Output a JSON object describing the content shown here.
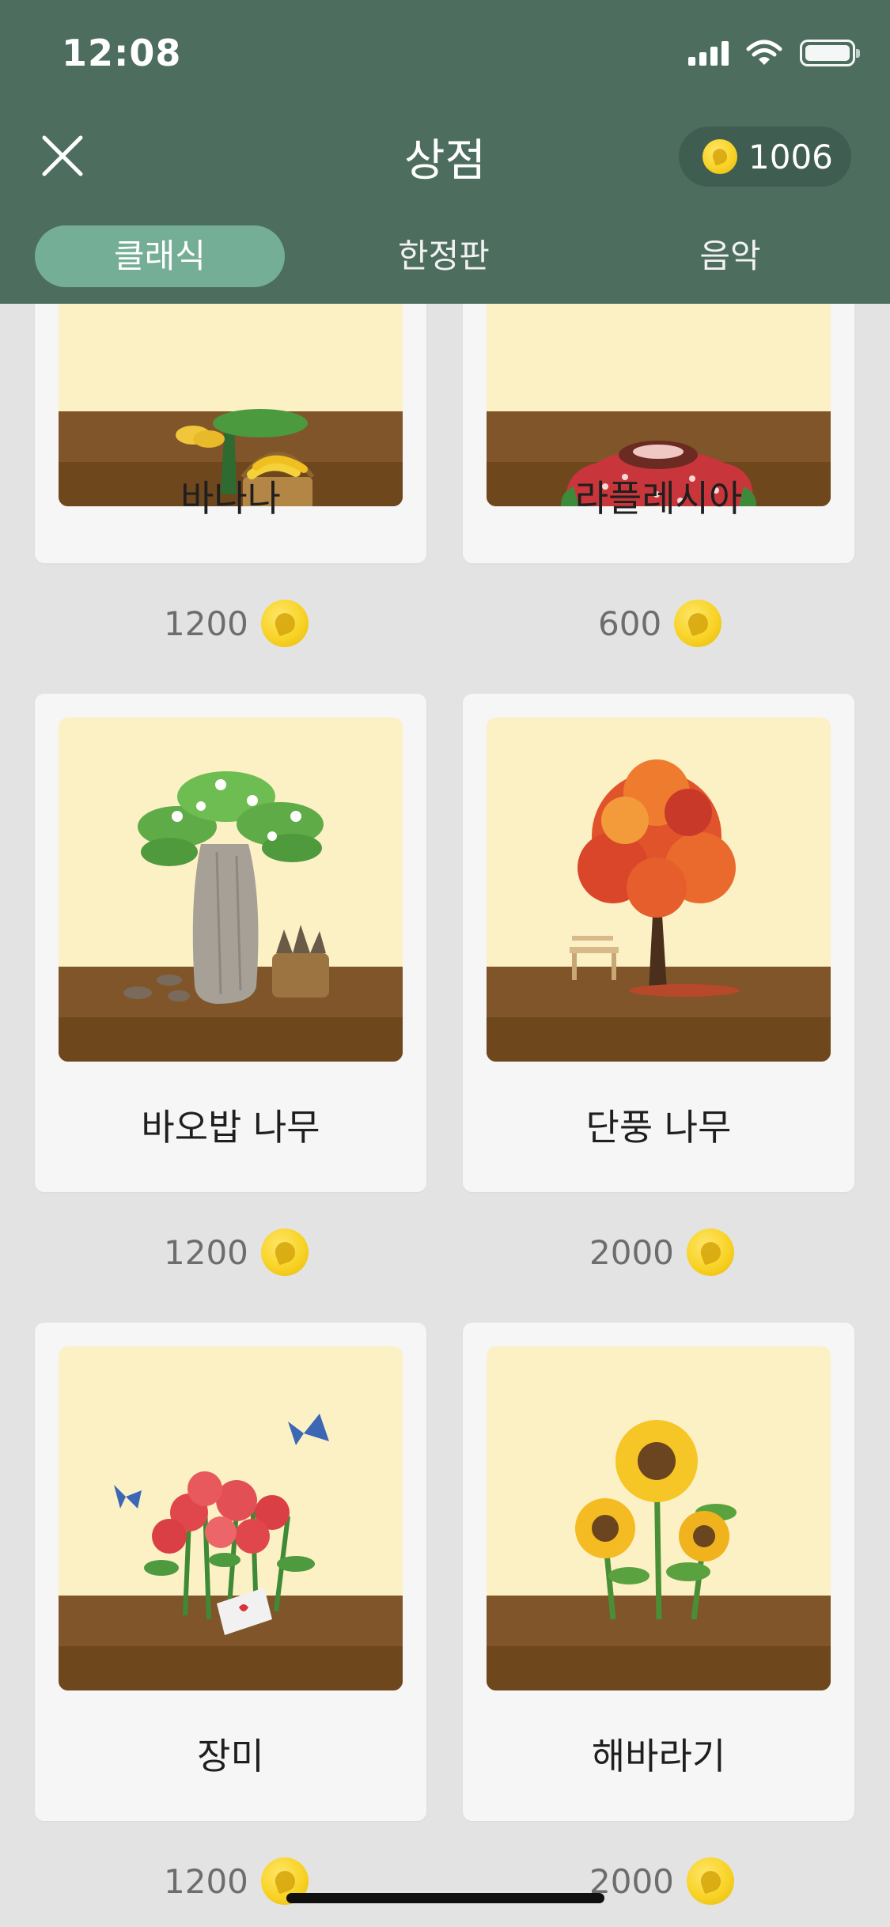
{
  "status": {
    "time": "12:08"
  },
  "header": {
    "title": "상점",
    "coin_balance": "1006",
    "tabs": [
      {
        "label": "클래식",
        "active": true
      },
      {
        "label": "한정판",
        "active": false
      },
      {
        "label": "음악",
        "active": false
      }
    ]
  },
  "items": [
    {
      "name": "바나나",
      "price": "1200",
      "icon": "banana-plant-icon"
    },
    {
      "name": "라플레시아",
      "price": "600",
      "icon": "rafflesia-icon"
    },
    {
      "name": "바오밥 나무",
      "price": "1200",
      "icon": "baobab-tree-icon"
    },
    {
      "name": "단풍 나무",
      "price": "2000",
      "icon": "maple-tree-icon"
    },
    {
      "name": "장미",
      "price": "1200",
      "icon": "rose-icon"
    },
    {
      "name": "해바라기",
      "price": "2000",
      "icon": "sunflower-icon"
    }
  ],
  "colors": {
    "header_bg": "#4d6e5f",
    "active_tab": "#75ae96",
    "coin": "#f8d326",
    "card_bg": "#f6f6f6",
    "scene_bg": "#fcf0c5",
    "ground": "#80552a"
  }
}
